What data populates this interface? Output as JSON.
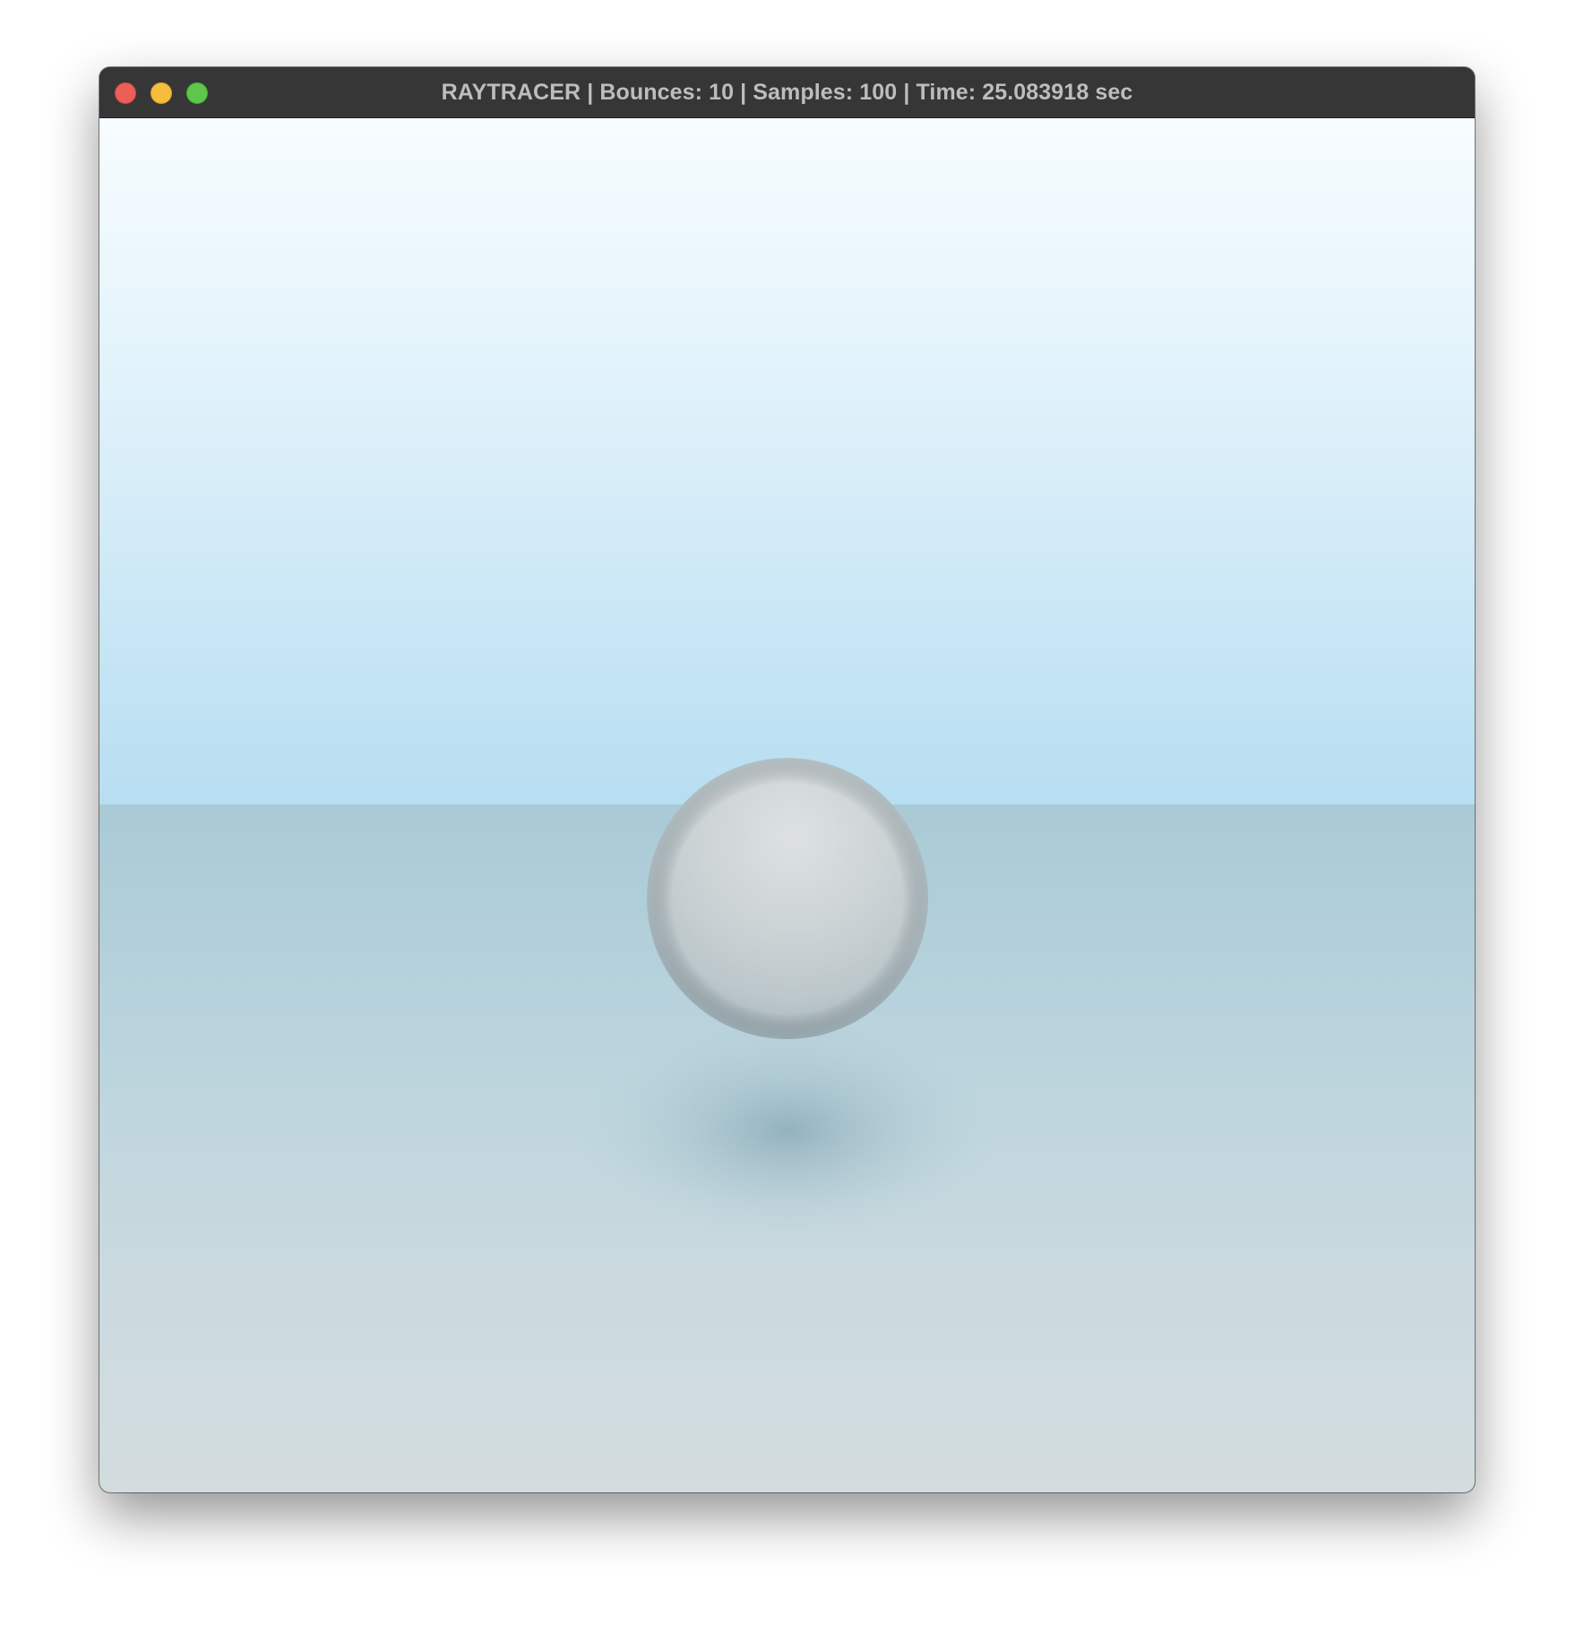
{
  "window": {
    "title": "RAYTRACER | Bounces: 10 | Samples: 100 | Time: 25.083918 sec",
    "controls": {
      "close": "close-button",
      "minimize": "minimize-button",
      "zoom": "zoom-button"
    }
  },
  "render": {
    "bounces": 10,
    "samples": 100,
    "time_seconds": 25.083918,
    "scene": {
      "sky_top_color": "#f7fcff",
      "sky_horizon_color": "#b7def1",
      "ground_horizon_color": "#a9cad6",
      "ground_bottom_color": "#d3dcdf",
      "sphere_color": "#cdd3d6"
    }
  },
  "colors": {
    "titlebar": "#363636",
    "title_text": "#bdbdbd",
    "close": "#ec5f57",
    "minimize": "#f4bd3b",
    "zoom": "#5ec64b"
  }
}
